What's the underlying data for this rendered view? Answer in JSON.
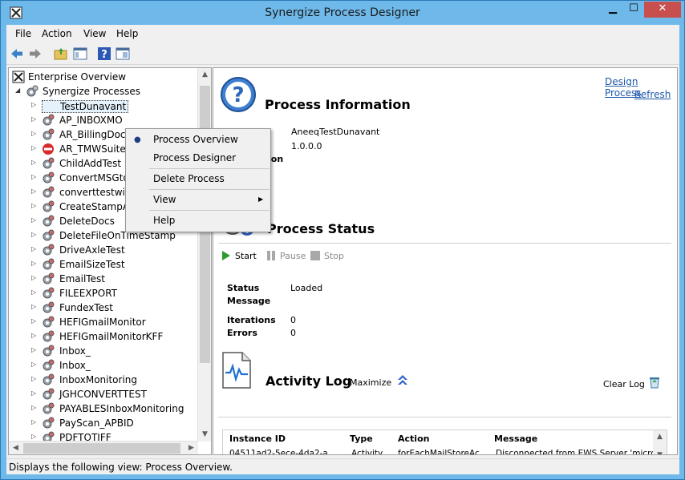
{
  "window": {
    "title": "Synergize Process Designer"
  },
  "menu": [
    "File",
    "Action",
    "View",
    "Help"
  ],
  "tree": {
    "root": "Enterprise Overview",
    "group": "Synergize Processes",
    "items": [
      {
        "label": "TestDunavant",
        "icon": "process-icon",
        "selected": true
      },
      {
        "label": "AP_INBOXMO",
        "icon": "process-icon"
      },
      {
        "label": "AR_BillingDocs",
        "icon": "process-icon"
      },
      {
        "label": "AR_TMWSuite",
        "icon": "stopped-icon"
      },
      {
        "label": "ChildAddTest",
        "icon": "process-icon"
      },
      {
        "label": "ConvertMSGto",
        "icon": "process-icon"
      },
      {
        "label": "converttestwit",
        "icon": "process-icon"
      },
      {
        "label": "CreateStampAnnotation",
        "icon": "process-icon"
      },
      {
        "label": "DeleteDocs",
        "icon": "process-icon"
      },
      {
        "label": "DeleteFileOnTimeStamp",
        "icon": "process-icon"
      },
      {
        "label": "DriveAxleTest",
        "icon": "process-icon"
      },
      {
        "label": "EmailSizeTest",
        "icon": "process-icon"
      },
      {
        "label": "EmailTest",
        "icon": "process-icon"
      },
      {
        "label": "FILEEXPORT",
        "icon": "process-icon"
      },
      {
        "label": "FundexTest",
        "icon": "process-icon"
      },
      {
        "label": "HEFIGmailMonitor",
        "icon": "process-icon"
      },
      {
        "label": "HEFIGmailMonitorKFF",
        "icon": "process-icon"
      },
      {
        "label": "Inbox_",
        "icon": "process-icon"
      },
      {
        "label": "Inbox_",
        "icon": "process-icon"
      },
      {
        "label": "InboxMonitoring",
        "icon": "process-icon"
      },
      {
        "label": "JGHCONVERTTEST",
        "icon": "process-icon"
      },
      {
        "label": "PAYABLESInboxMonitoring",
        "icon": "process-icon"
      },
      {
        "label": "PayScan_APBID",
        "icon": "process-icon"
      },
      {
        "label": "PDFTOTIFF",
        "icon": "process-icon"
      }
    ]
  },
  "context_menu": {
    "items": [
      "Process Overview",
      "Process Designer",
      "Delete Process",
      "View",
      "Help"
    ],
    "checked": "Process Overview"
  },
  "process_info": {
    "title": "Process Information",
    "name": "AneeqTestDunavant",
    "version": "1.0.0.0",
    "partial_label": "ion"
  },
  "links": {
    "design": "Design Process",
    "refresh": "Refresh"
  },
  "process_status": {
    "title": "Process Status",
    "start": "Start",
    "pause": "Pause",
    "stop": "Stop",
    "status_label": "Status",
    "status_value": "Loaded",
    "message_label": "Message",
    "iterations_label": "Iterations",
    "iterations_value": "0",
    "errors_label": "Errors",
    "errors_value": "0"
  },
  "activity_log": {
    "title": "Activity Log",
    "maximize": "Maximize",
    "clear": "Clear Log",
    "columns": [
      "Instance ID",
      "Type",
      "Action",
      "Message"
    ],
    "rows": [
      [
        "04511ad2-5ece-4da2-a",
        "Activity",
        "forEachMailStoreAc...",
        "Disconnected from EWS Server 'microdea"
      ]
    ]
  },
  "status_bar": "Displays the following view: Process Overview.",
  "colors": {
    "titlebar": "#6fb9ea",
    "close": "#c7504f",
    "link": "#1d57a8"
  }
}
